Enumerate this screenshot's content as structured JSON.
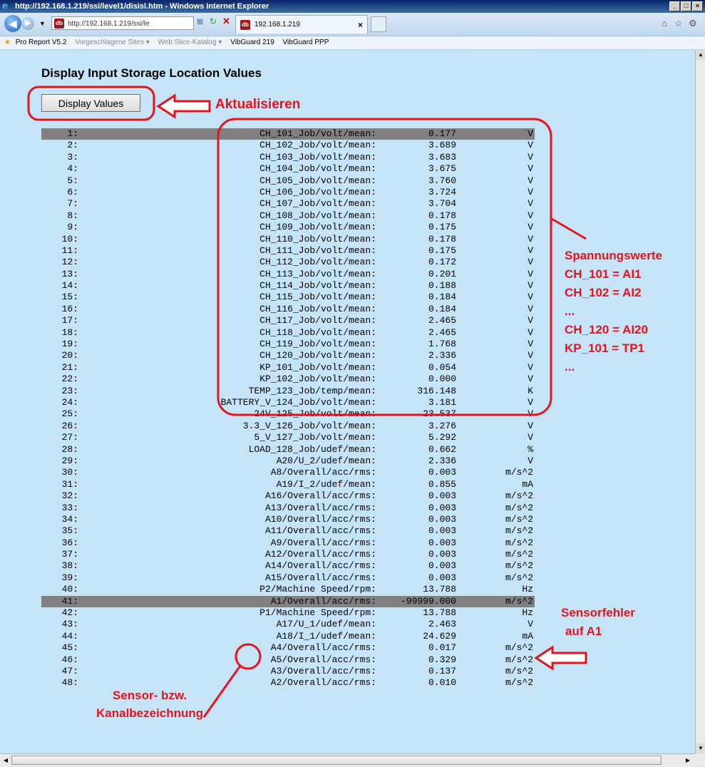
{
  "window": {
    "title": "http://192.168.1.219/ssi/level1/disisl.htm - Windows Internet Explorer",
    "address": "http://192.168.1.219/ssi/le",
    "tab_title": "192.168.1.219"
  },
  "favorites": [
    "Pro Report V5.2",
    "Vorgeschlagene Sites ▾",
    "Web Slice-Katalog ▾",
    "VibGuard 219",
    "VibGuard PPP"
  ],
  "page": {
    "heading": "Display Input Storage Location Values",
    "button_label": "Display Values"
  },
  "rows": [
    {
      "idx": "1:",
      "label": "CH_101_Job/volt/mean:",
      "value": "0.177",
      "unit": "V",
      "highlight": true
    },
    {
      "idx": "2:",
      "label": "CH_102_Job/volt/mean:",
      "value": "3.689",
      "unit": "V"
    },
    {
      "idx": "3:",
      "label": "CH_103_Job/volt/mean:",
      "value": "3.683",
      "unit": "V"
    },
    {
      "idx": "4:",
      "label": "CH_104_Job/volt/mean:",
      "value": "3.675",
      "unit": "V"
    },
    {
      "idx": "5:",
      "label": "CH_105_Job/volt/mean:",
      "value": "3.760",
      "unit": "V"
    },
    {
      "idx": "6:",
      "label": "CH_106_Job/volt/mean:",
      "value": "3.724",
      "unit": "V"
    },
    {
      "idx": "7:",
      "label": "CH_107_Job/volt/mean:",
      "value": "3.704",
      "unit": "V"
    },
    {
      "idx": "8:",
      "label": "CH_108_Job/volt/mean:",
      "value": "0.178",
      "unit": "V"
    },
    {
      "idx": "9:",
      "label": "CH_109_Job/volt/mean:",
      "value": "0.175",
      "unit": "V"
    },
    {
      "idx": "10:",
      "label": "CH_110_Job/volt/mean:",
      "value": "0.178",
      "unit": "V"
    },
    {
      "idx": "11:",
      "label": "CH_111_Job/volt/mean:",
      "value": "0.175",
      "unit": "V"
    },
    {
      "idx": "12:",
      "label": "CH_112_Job/volt/mean:",
      "value": "0.172",
      "unit": "V"
    },
    {
      "idx": "13:",
      "label": "CH_113_Job/volt/mean:",
      "value": "0.201",
      "unit": "V"
    },
    {
      "idx": "14:",
      "label": "CH_114_Job/volt/mean:",
      "value": "0.188",
      "unit": "V"
    },
    {
      "idx": "15:",
      "label": "CH_115_Job/volt/mean:",
      "value": "0.184",
      "unit": "V"
    },
    {
      "idx": "16:",
      "label": "CH_116_Job/volt/mean:",
      "value": "0.184",
      "unit": "V"
    },
    {
      "idx": "17:",
      "label": "CH_117_Job/volt/mean:",
      "value": "2.465",
      "unit": "V"
    },
    {
      "idx": "18:",
      "label": "CH_118_Job/volt/mean:",
      "value": "2.465",
      "unit": "V"
    },
    {
      "idx": "19:",
      "label": "CH_119_Job/volt/mean:",
      "value": "1.768",
      "unit": "V"
    },
    {
      "idx": "20:",
      "label": "CH_120_Job/volt/mean:",
      "value": "2.336",
      "unit": "V"
    },
    {
      "idx": "21:",
      "label": "KP_101_Job/volt/mean:",
      "value": "0.054",
      "unit": "V"
    },
    {
      "idx": "22:",
      "label": "KP_102_Job/volt/mean:",
      "value": "0.000",
      "unit": "V"
    },
    {
      "idx": "23:",
      "label": "TEMP_123_Job/temp/mean:",
      "value": "316.148",
      "unit": "K"
    },
    {
      "idx": "24:",
      "label": "BATTERY_V_124_Job/volt/mean:",
      "value": "3.181",
      "unit": "V"
    },
    {
      "idx": "25:",
      "label": "24V_125_Job/volt/mean:",
      "value": "23.537",
      "unit": "V"
    },
    {
      "idx": "26:",
      "label": "3.3_V_126_Job/volt/mean:",
      "value": "3.276",
      "unit": "V"
    },
    {
      "idx": "27:",
      "label": "5_V_127_Job/volt/mean:",
      "value": "5.292",
      "unit": "V"
    },
    {
      "idx": "28:",
      "label": "LOAD_128_Job/udef/mean:",
      "value": "0.662",
      "unit": "%"
    },
    {
      "idx": "29:",
      "label": "A20/U_2/udef/mean:",
      "value": "2.336",
      "unit": "V"
    },
    {
      "idx": "30:",
      "label": "A8/Overall/acc/rms:",
      "value": "0.003",
      "unit": "m/s^2"
    },
    {
      "idx": "31:",
      "label": "A19/I_2/udef/mean:",
      "value": "0.855",
      "unit": "mA"
    },
    {
      "idx": "32:",
      "label": "A16/Overall/acc/rms:",
      "value": "0.003",
      "unit": "m/s^2"
    },
    {
      "idx": "33:",
      "label": "A13/Overall/acc/rms:",
      "value": "0.003",
      "unit": "m/s^2"
    },
    {
      "idx": "34:",
      "label": "A10/Overall/acc/rms:",
      "value": "0.003",
      "unit": "m/s^2"
    },
    {
      "idx": "35:",
      "label": "A11/Overall/acc/rms:",
      "value": "0.003",
      "unit": "m/s^2"
    },
    {
      "idx": "36:",
      "label": "A9/Overall/acc/rms:",
      "value": "0.003",
      "unit": "m/s^2"
    },
    {
      "idx": "37:",
      "label": "A12/Overall/acc/rms:",
      "value": "0.003",
      "unit": "m/s^2"
    },
    {
      "idx": "38:",
      "label": "A14/Overall/acc/rms:",
      "value": "0.003",
      "unit": "m/s^2"
    },
    {
      "idx": "39:",
      "label": "A15/Overall/acc/rms:",
      "value": "0.003",
      "unit": "m/s^2"
    },
    {
      "idx": "40:",
      "label": "P2/Machine Speed/rpm:",
      "value": "13.788",
      "unit": "Hz"
    },
    {
      "idx": "41:",
      "label": "A1/Overall/acc/rms:",
      "value": "-99999.000",
      "unit": "m/s^2",
      "highlight": true
    },
    {
      "idx": "42:",
      "label": "P1/Machine Speed/rpm:",
      "value": "13.788",
      "unit": "Hz"
    },
    {
      "idx": "43:",
      "label": "A17/U_1/udef/mean:",
      "value": "2.463",
      "unit": "V"
    },
    {
      "idx": "44:",
      "label": "A18/I_1/udef/mean:",
      "value": "24.629",
      "unit": "mA"
    },
    {
      "idx": "45:",
      "label": "A4/Overall/acc/rms:",
      "value": "0.017",
      "unit": "m/s^2"
    },
    {
      "idx": "46:",
      "label": "A5/Overall/acc/rms:",
      "value": "0.329",
      "unit": "m/s^2"
    },
    {
      "idx": "47:",
      "label": "A3/Overall/acc/rms:",
      "value": "0.137",
      "unit": "m/s^2"
    },
    {
      "idx": "48:",
      "label": "A2/Overall/acc/rms:",
      "value": "0.010",
      "unit": "m/s^2"
    }
  ],
  "annotations": {
    "refresh": "Aktualisieren",
    "voltage_lines": [
      "Spannungswerte",
      "CH_101 = AI1",
      "CH_102 = AI2",
      "...",
      "CH_120 = AI20",
      "KP_101 = TP1",
      "..."
    ],
    "sensor_error_lines": [
      "Sensorfehler",
      "auf A1"
    ],
    "channel_name_lines": [
      "Sensor- bzw.",
      "Kanalbezeichnung"
    ],
    "color": "#e3141c"
  }
}
